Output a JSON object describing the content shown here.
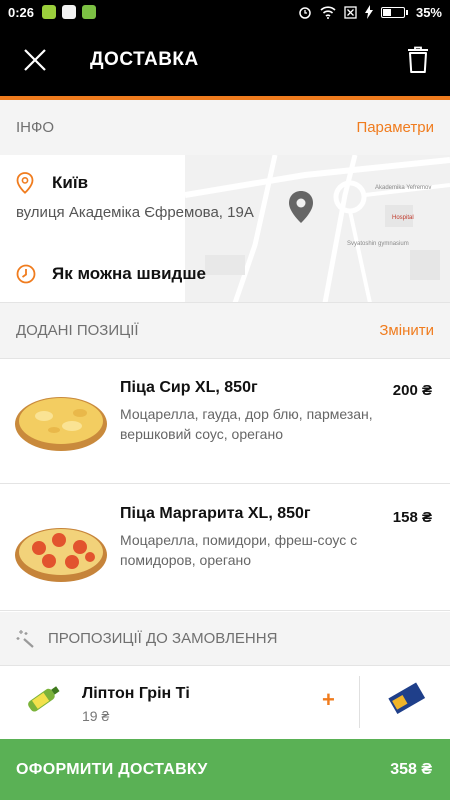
{
  "status_bar": {
    "time": "0:26",
    "battery_level": "35%",
    "battery_fraction": 0.35
  },
  "header": {
    "title": "ДОСТАВКА",
    "close_icon": "close-icon",
    "trash_icon": "trash-icon"
  },
  "info_section": {
    "title": "ІНФО",
    "action": "Параметри"
  },
  "location": {
    "city": "Київ",
    "address": "вулиця Академіка Єфремова, 19А",
    "time": "Як можна швидше",
    "map_labels": {
      "street": "Akademika Yefremov",
      "hospital": "Hospital",
      "gymnasium": "Svyatoshin gymnasium"
    }
  },
  "added_section": {
    "title": "ДОДАНІ ПОЗИЦІЇ",
    "action": "Змінити"
  },
  "items": [
    {
      "name": "Піца Сир XL, 850г",
      "description": "Моцарелла, гауда, дор блю, пармезан, вершковий соус, орегано",
      "price": "200 ₴"
    },
    {
      "name": "Піца Маргарита XL, 850г",
      "description": "Моцарелла, помидори, фреш-соус с помидоров, орегано",
      "price": "158 ₴"
    }
  ],
  "suggestions": {
    "title": "ПРОПОЗИЦІЇ ДО ЗАМОВЛЕННЯ",
    "items": [
      {
        "name": "Ліптон Грін Ті",
        "price": "19 ₴",
        "add": "+"
      }
    ]
  },
  "checkout": {
    "label": "ОФОРМИТИ ДОСТАВКУ",
    "total": "358 ₴"
  },
  "colors": {
    "accent": "#f07c1e",
    "checkout": "#5ab155",
    "header": "#000000"
  }
}
